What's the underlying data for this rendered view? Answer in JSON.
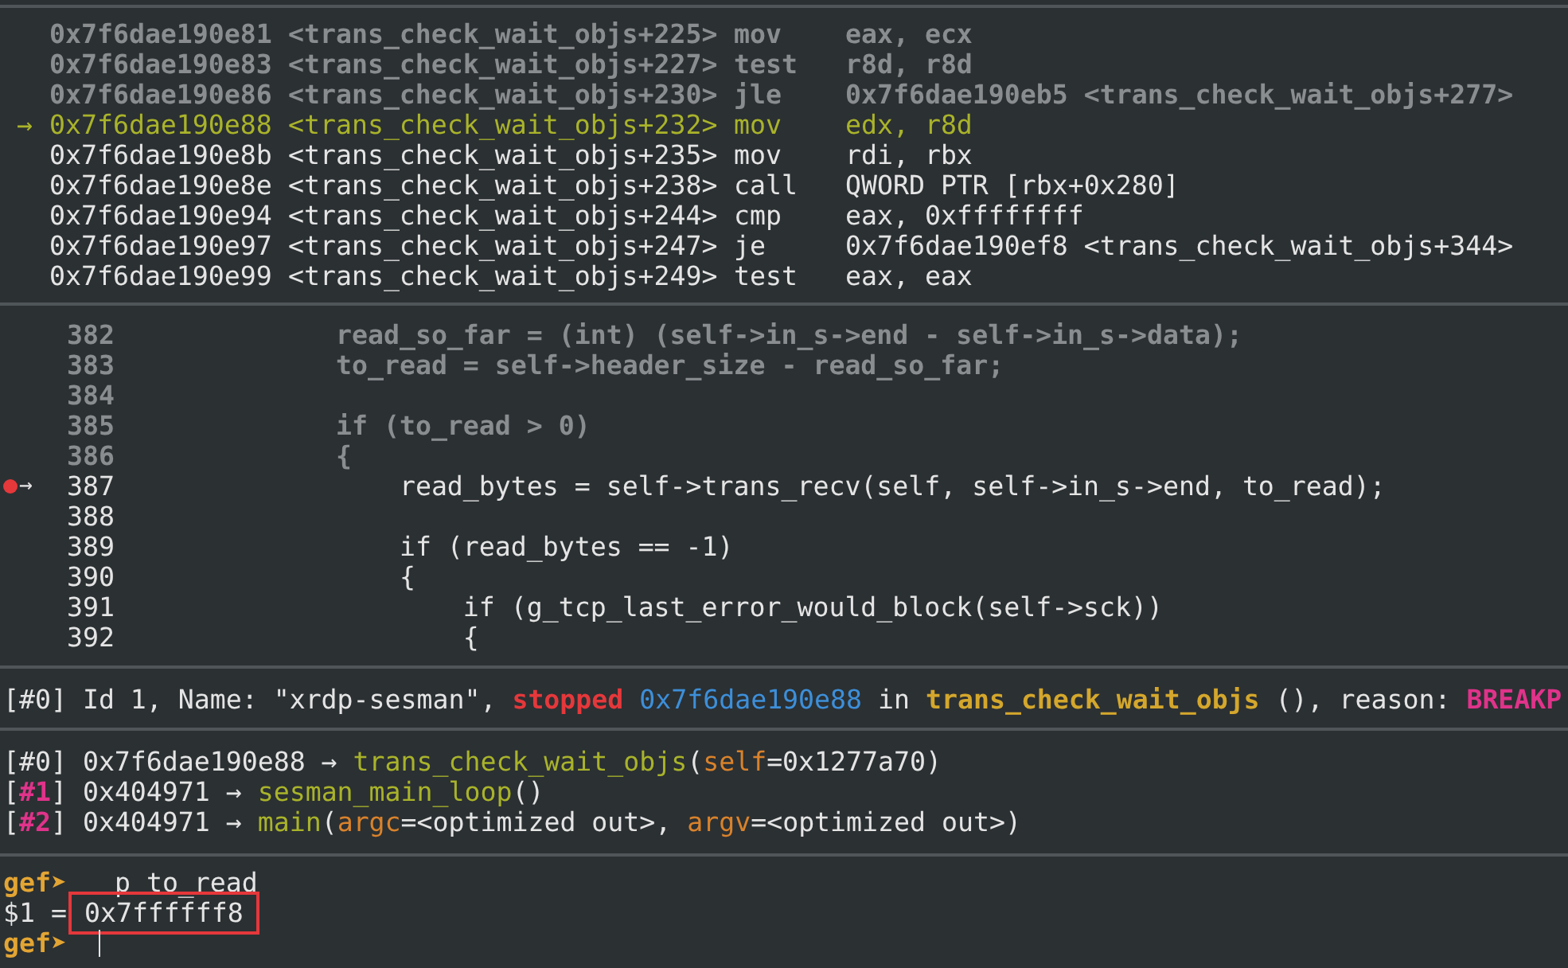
{
  "disassembly": [
    {
      "address": "0x7f6dae190e81",
      "symbol": "<trans_check_wait_objs+225>",
      "mnemonic": "mov",
      "operands": "eax, ecx",
      "executed": true,
      "current": false
    },
    {
      "address": "0x7f6dae190e83",
      "symbol": "<trans_check_wait_objs+227>",
      "mnemonic": "test",
      "operands": "r8d, r8d",
      "executed": true,
      "current": false
    },
    {
      "address": "0x7f6dae190e86",
      "symbol": "<trans_check_wait_objs+230>",
      "mnemonic": "jle",
      "operands": "0x7f6dae190eb5 <trans_check_wait_objs+277>",
      "executed": true,
      "current": false
    },
    {
      "marker": "→",
      "address": "0x7f6dae190e88",
      "symbol": "<trans_check_wait_objs+232>",
      "mnemonic": "mov",
      "operands": "edx, r8d",
      "executed": false,
      "current": true
    },
    {
      "address": "0x7f6dae190e8b",
      "symbol": "<trans_check_wait_objs+235>",
      "mnemonic": "mov",
      "operands": "rdi, rbx",
      "executed": false,
      "current": false
    },
    {
      "address": "0x7f6dae190e8e",
      "symbol": "<trans_check_wait_objs+238>",
      "mnemonic": "call",
      "operands": "QWORD PTR [rbx+0x280]",
      "executed": false,
      "current": false
    },
    {
      "address": "0x7f6dae190e94",
      "symbol": "<trans_check_wait_objs+244>",
      "mnemonic": "cmp",
      "operands": "eax, 0xffffffff",
      "executed": false,
      "current": false
    },
    {
      "address": "0x7f6dae190e97",
      "symbol": "<trans_check_wait_objs+247>",
      "mnemonic": "je",
      "operands": "0x7f6dae190ef8 <trans_check_wait_objs+344>",
      "executed": false,
      "current": false
    },
    {
      "address": "0x7f6dae190e99",
      "symbol": "<trans_check_wait_objs+249>",
      "mnemonic": "test",
      "operands": "eax, eax",
      "executed": false,
      "current": false
    }
  ],
  "source": [
    {
      "number": "382",
      "code": "read_so_far = (int) (self->in_s->end - self->in_s->data);",
      "dimmed": true,
      "breakpoint": false
    },
    {
      "number": "383",
      "code": "to_read = self->header_size - read_so_far;",
      "dimmed": true,
      "breakpoint": false
    },
    {
      "number": "384",
      "dimmed": true,
      "breakpoint": false
    },
    {
      "number": "385",
      "code": "if (to_read > 0)",
      "dimmed": true,
      "breakpoint": false
    },
    {
      "number": "386",
      "code": "{",
      "dimmed": true,
      "breakpoint": false
    },
    {
      "number": "387",
      "code": "    read_bytes = self->trans_recv(self, self->in_s->end, to_read);",
      "dimmed": false,
      "breakpoint": true,
      "marker": "→"
    },
    {
      "number": "388",
      "dimmed": false,
      "breakpoint": false
    },
    {
      "number": "389",
      "code": "    if (read_bytes == -1)",
      "dimmed": false,
      "breakpoint": false
    },
    {
      "number": "390",
      "code": "    {",
      "dimmed": false,
      "breakpoint": false
    },
    {
      "number": "391",
      "code": "        if (g_tcp_last_error_would_block(self->sck))",
      "dimmed": false,
      "breakpoint": false
    },
    {
      "number": "392",
      "code": "        {",
      "dimmed": false,
      "breakpoint": false
    }
  ],
  "thread": [
    {
      "kind": "text",
      "text": "[#0] Id 1, Name: \"xrdp-sesman\","
    },
    {
      "kind": "stopped",
      "text": "stopped"
    },
    {
      "kind": "address",
      "text": "0x7f6dae190e88"
    },
    {
      "kind": "text",
      "text": "in"
    },
    {
      "kind": "function",
      "text": "trans_check_wait_objs"
    },
    {
      "kind": "text",
      "text": "(), reason:"
    },
    {
      "kind": "reason",
      "text": "BREAKP"
    }
  ],
  "trace": [
    [
      {
        "kind": "text",
        "text": "[#0] 0x7f6dae190e88 → "
      },
      {
        "kind": "callee",
        "text": "trans_check_wait_objs"
      },
      {
        "kind": "text",
        "text": "("
      },
      {
        "kind": "arg",
        "text": "self"
      },
      {
        "kind": "text",
        "text": "=0x1277a70)"
      }
    ],
    [
      {
        "kind": "text",
        "text": "["
      },
      {
        "kind": "frame",
        "text": "#1"
      },
      {
        "kind": "text",
        "text": "] 0x404971 → "
      },
      {
        "kind": "callee",
        "text": "sesman_main_loop"
      },
      {
        "kind": "text",
        "text": "()"
      }
    ],
    [
      {
        "kind": "text",
        "text": "["
      },
      {
        "kind": "frame",
        "text": "#2"
      },
      {
        "kind": "text",
        "text": "] 0x404971 → "
      },
      {
        "kind": "callee",
        "text": "main"
      },
      {
        "kind": "text",
        "text": "("
      },
      {
        "kind": "arg",
        "text": "argc"
      },
      {
        "kind": "text",
        "text": "=<optimized out>, "
      },
      {
        "kind": "arg",
        "text": "argv"
      },
      {
        "kind": "text",
        "text": "=<optimized out>)"
      }
    ]
  ],
  "console": [
    [
      {
        "kind": "prompt",
        "text": "gef➤"
      },
      {
        "kind": "command",
        "text": "p to_read"
      }
    ],
    [
      {
        "kind": "text",
        "text": "$1 ="
      },
      {
        "kind": "value",
        "text": "0x7ffffff8"
      }
    ],
    [
      {
        "kind": "prompt",
        "text": "gef➤"
      },
      {
        "kind": "cursor"
      }
    ]
  ]
}
